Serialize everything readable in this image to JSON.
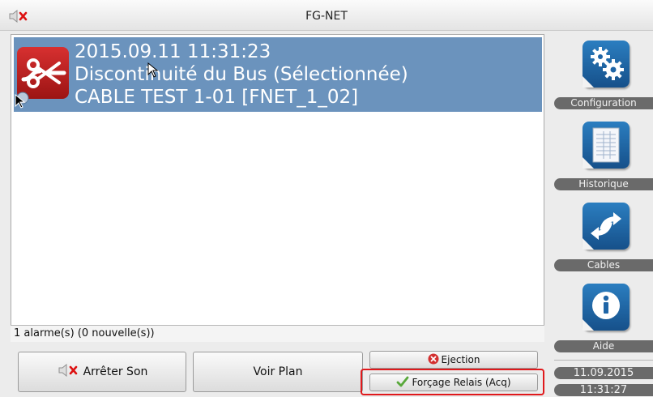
{
  "window": {
    "title": "FG-NET"
  },
  "icons": {
    "mute": "speaker-muted-icon",
    "alarm": "cut-cable-icon",
    "config": "gears-icon",
    "history": "document-icon",
    "cables": "swap-arrows-icon",
    "help": "info-icon"
  },
  "alarm": {
    "datetime": "2015.09.11 11:31:23",
    "type": "Discontinuité du Bus (Sélectionnée)",
    "location": "CABLE TEST 1-01 [FNET_1_02]"
  },
  "status": {
    "summary": "1 alarme(s) (0 nouvelle(s))"
  },
  "buttons": {
    "stop_sound": "Arrêter Son",
    "view_plan": "Voir Plan",
    "ejection": "Ejection",
    "force_relay": "Forçage Relais (Acq)"
  },
  "sidebar": {
    "configuration": "Configuration",
    "history": "Historique",
    "cables": "Cables",
    "help": "Aide"
  },
  "clock": {
    "date": "11.09.2015",
    "time": "11:31:27"
  },
  "colors": {
    "selection": "#6b93bd",
    "alarm_red": "#c62828",
    "sidebar_icon": "#1f65a6",
    "highlight": "#e0191c"
  }
}
